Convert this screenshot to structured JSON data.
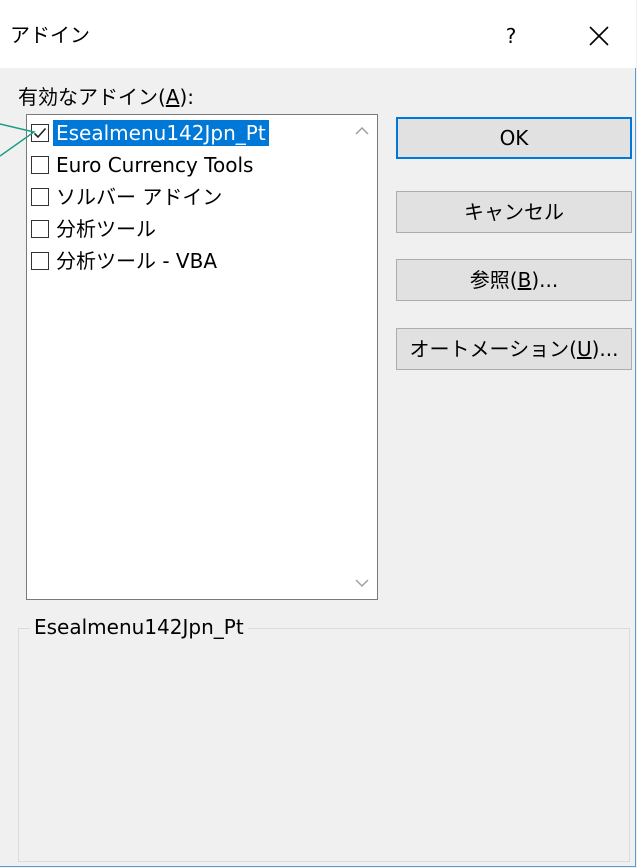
{
  "dialog": {
    "title": "アドイン",
    "help_label": "?",
    "list_label": {
      "prefix": "有効なアドイン(",
      "accel": "A",
      "suffix": "):"
    },
    "addins": [
      {
        "label": "Esealmenu142Jpn_Pt",
        "checked": true,
        "selected": true
      },
      {
        "label": "Euro Currency Tools",
        "checked": false,
        "selected": false
      },
      {
        "label": "ソルバー アドイン",
        "checked": false,
        "selected": false
      },
      {
        "label": "分析ツール",
        "checked": false,
        "selected": false
      },
      {
        "label": "分析ツール - VBA",
        "checked": false,
        "selected": false
      }
    ],
    "buttons": {
      "ok": "OK",
      "cancel": "キャンセル",
      "browse": {
        "prefix": "参照(",
        "accel": "B",
        "suffix": ")..."
      },
      "automation": {
        "prefix": "オートメーション(",
        "accel": "U",
        "suffix": ")..."
      }
    },
    "description": {
      "legend": "Esealmenu142Jpn_Pt",
      "text": ""
    },
    "colors": {
      "selection": "#0078d7",
      "callout": "#1a9c86",
      "default_border": "#0078d7"
    }
  }
}
